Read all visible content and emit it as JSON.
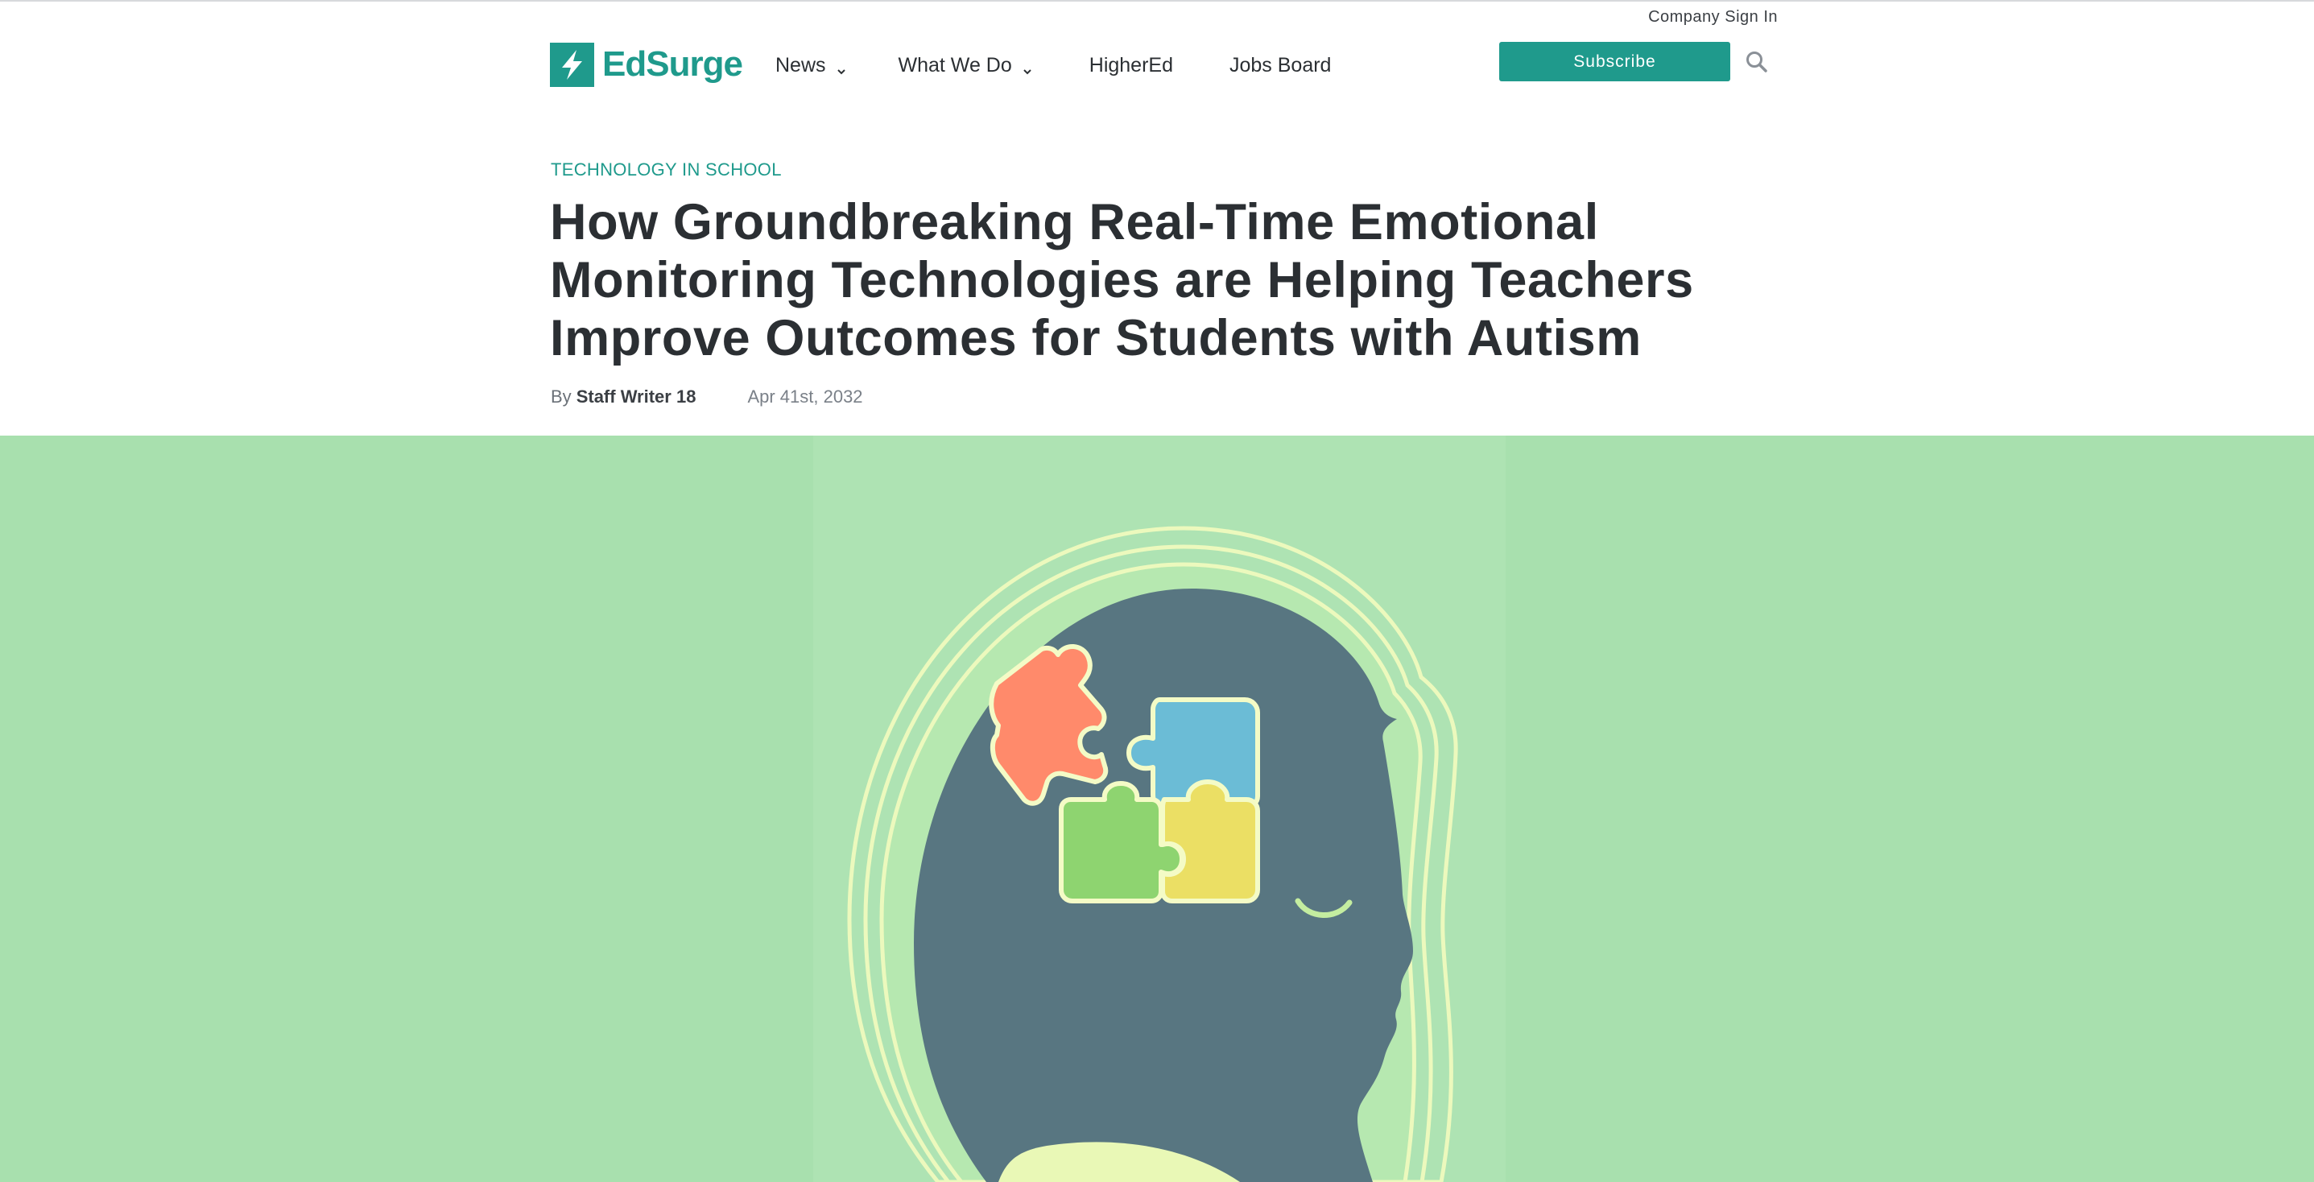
{
  "header": {
    "company_sign_in": "Company Sign In",
    "logo_text": "EdSurge",
    "nav": [
      {
        "label": "News",
        "has_dropdown": true
      },
      {
        "label": "What We Do",
        "has_dropdown": true
      },
      {
        "label": "HigherEd",
        "has_dropdown": false
      },
      {
        "label": "Jobs Board",
        "has_dropdown": false
      }
    ],
    "subscribe_label": "Subscribe",
    "search_icon": "search-icon"
  },
  "article": {
    "category": "TECHNOLOGY IN SCHOOL",
    "title": "How Groundbreaking Real-Time Emotional Monitoring Technologies are Helping Teachers Improve Outcomes for Students with Autism",
    "byline_prefix": "By",
    "author": "Staff Writer 18",
    "date": "Apr 41st, 2032"
  },
  "hero_image": {
    "icon": "head-with-puzzle-pieces-illustration"
  },
  "colors": {
    "brand": "#1f9a8c",
    "hero_background": "#a8e0ae",
    "head": "#587681",
    "puzzle_orange": "#ff8a6b",
    "puzzle_blue": "#6bbcd6",
    "puzzle_green": "#8ed470",
    "puzzle_yellow": "#ebdf64",
    "outline": "#e9f8b6"
  }
}
